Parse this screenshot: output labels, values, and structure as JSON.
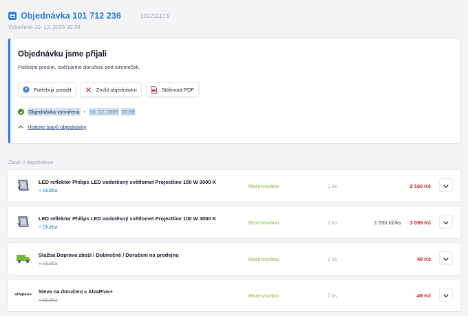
{
  "header": {
    "title": "Objednávka 101 712 236",
    "code": "101711173",
    "created": "Vytvořeno 10. 12. 2025 20:39"
  },
  "status": {
    "title": "Objednávku jsme přijali",
    "subtitle": "Počkejte prosím, ověřujeme doručení pod stromeček.",
    "buttons": {
      "help": "Potřebuji poradit",
      "cancel": "Zrušit objednávku",
      "pdf": "Stáhnout PDF"
    },
    "timeline": {
      "label": "Objednávka vytvořena",
      "separator": "•",
      "date": "10. 12. 2025",
      "time": "20:39"
    },
    "history_link": "Historie stavů objednávky"
  },
  "items_section_title": "Zboží v objednávce",
  "items": [
    {
      "name": "LED reflektor Philips LED vodotěsný světlomet Projectline 150 W 3000 K",
      "service": "+ Služba",
      "status": "Rezervováno",
      "qty": "1 ks",
      "unit_price": "",
      "price": "2 160 Kč",
      "icon": "floodlight-icon"
    },
    {
      "name": "LED reflektor Philips LED vodotěsný světlomet Projectline 100 W 3000 K",
      "service": "+ Služba",
      "status": "Rezervováno",
      "qty": "2 ks",
      "unit_price": "1 550 Kč/ks",
      "price": "3 099 Kč",
      "icon": "floodlight-icon"
    },
    {
      "name": "Služba Doprava zboží / Dobirečné / Doručení na prodejnu",
      "service": "+ Služba",
      "status": "Rezervováno",
      "qty": "1 ks",
      "unit_price": "",
      "price": "49 Kč",
      "icon": "truck-icon"
    },
    {
      "name": "Sleva na doručení s AlzaPlus+",
      "service": "+ Služba",
      "status": "Rezervováno",
      "qty": "1 ks",
      "unit_price": "",
      "price": "-49 Kč",
      "icon": "alzaplus-logo-icon",
      "logo_text": "alzaplus+"
    }
  ],
  "colors": {
    "accent": "#2e7bd8",
    "price": "#c81e1e",
    "status": "#8bb83a",
    "success": "#3f8b1f"
  }
}
